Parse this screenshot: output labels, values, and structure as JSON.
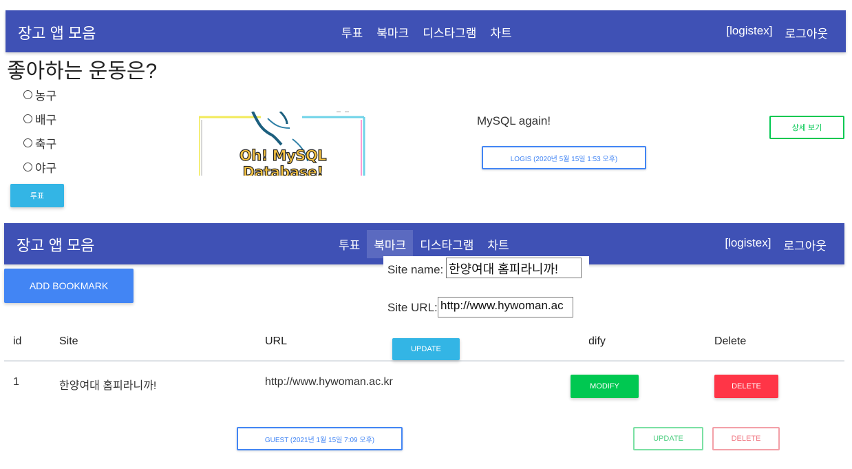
{
  "navbar": {
    "brand": "장고 앱 모음",
    "menu": [
      "투표",
      "북마크",
      "디스타그램",
      "차트"
    ],
    "user": "[logistex]",
    "logout": "로그아웃"
  },
  "poll": {
    "question": "좋아하는 운동은?",
    "options": [
      "농구",
      "배구",
      "축구",
      "야구"
    ],
    "vote_button": "투표"
  },
  "post": {
    "image_text": "Oh! MySQL Database!",
    "title": "MySQL again!",
    "author_button": "LOGIS (2020년 5월 15일 1:53 오후)",
    "detail_button": "상세 보기"
  },
  "bookmark": {
    "add_button": "ADD BOOKMARK",
    "form": {
      "site_name_label": "Site name:",
      "site_name_value": "한양여대 홈피라니까!",
      "site_url_label": "Site URL:",
      "site_url_value": "http://www.hywoman.ac",
      "update_button": "UPDATE"
    },
    "table": {
      "headers": [
        "id",
        "Site",
        "URL",
        "dify",
        "Delete"
      ],
      "rows": [
        {
          "id": "1",
          "site": "한양여대 홈피라니까!",
          "url": "http://www.hywoman.ac.kr",
          "modify": "MODIFY",
          "delete": "DELETE"
        }
      ]
    },
    "footer": {
      "guest_button": "GUEST (2021년 1월 15일 7:09 오후)",
      "update_button": "UPDATE",
      "delete_button": "DELETE"
    }
  },
  "colors": {
    "navbar": "#3f51b5",
    "info": "#33b5e5",
    "primary": "#4285f4",
    "success": "#00c851",
    "danger": "#ff3547"
  }
}
